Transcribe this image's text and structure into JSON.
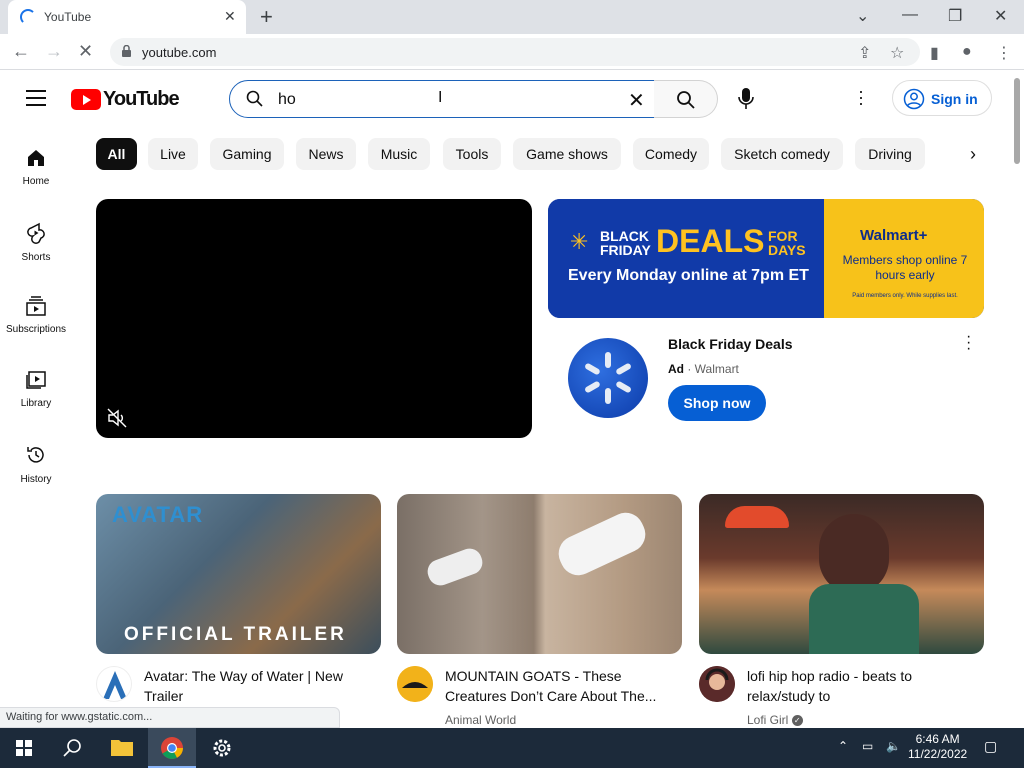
{
  "browser": {
    "tab_title": "YouTube",
    "tab_close": "✕",
    "new_tab": "+",
    "url": "youtube.com",
    "window_controls": [
      "⌄",
      "—",
      "❐",
      "✕"
    ]
  },
  "masthead": {
    "logo_text": "YouTube",
    "search_value": "ho",
    "signin_label": "Sign in"
  },
  "guide": [
    {
      "label": "Home",
      "icon": "home-icon"
    },
    {
      "label": "Shorts",
      "icon": "shorts-icon"
    },
    {
      "label": "Subscriptions",
      "icon": "subscriptions-icon"
    },
    {
      "label": "Library",
      "icon": "library-icon"
    },
    {
      "label": "History",
      "icon": "history-icon"
    }
  ],
  "chips": [
    "All",
    "Live",
    "Gaming",
    "News",
    "Music",
    "Tools",
    "Game shows",
    "Comedy",
    "Sketch comedy",
    "Driving"
  ],
  "ad": {
    "banner_black_friday": "BLACK FRIDAY",
    "banner_deals": "DEALS",
    "banner_for_days": "FOR DAYS",
    "banner_monday": "Every Monday online at 7pm ET",
    "banner_walmart_plus": "Walmart+",
    "banner_members": "Members shop online 7 hours early",
    "banner_fine_print": "Paid members only. While supplies last.",
    "title": "Black Friday Deals",
    "ad_label": "Ad",
    "advertiser": "Walmart",
    "cta": "Shop now"
  },
  "videos": [
    {
      "title": "Avatar: The Way of Water | New Trailer",
      "channel": "",
      "thumb_text_top": "AVATAR",
      "thumb_text_bottom": "OFFICIAL TRAILER"
    },
    {
      "title": "MOUNTAIN GOATS - These Creatures Don’t Care About The...",
      "channel": "Animal World"
    },
    {
      "title": "lofi hip hop radio - beats to relax/study to",
      "channel": "Lofi Girl"
    }
  ],
  "status_text": "Waiting for www.gstatic.com...",
  "taskbar": {
    "time": "6:46 AM",
    "date": "11/22/2022"
  },
  "colors": {
    "youtube_red": "#ff0000",
    "link_blue": "#065fd4",
    "chip_active": "#0f0f0f",
    "taskbar": "#1c2a3a"
  }
}
